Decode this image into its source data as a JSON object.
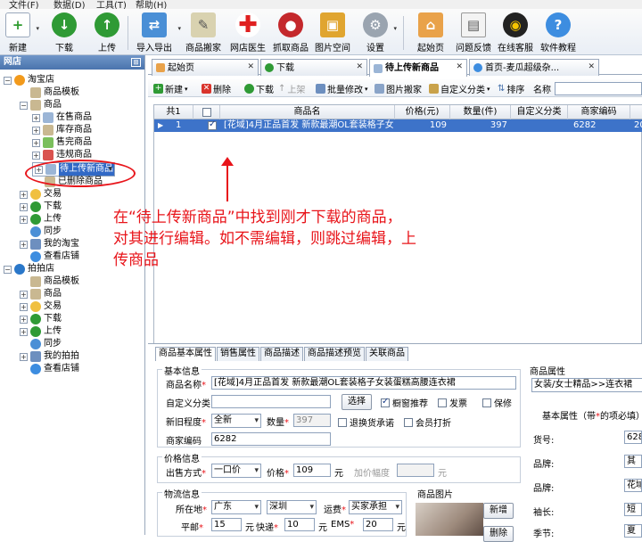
{
  "menu": {
    "items": [
      "文件(F)",
      "数据(D)",
      "工具(T)",
      "帮助(H)"
    ]
  },
  "toolbar": {
    "buttons": [
      {
        "label": "新建"
      },
      {
        "label": "下载"
      },
      {
        "label": "上传"
      },
      {
        "label": "导入导出"
      },
      {
        "label": "商品搬家"
      },
      {
        "label": "网店医生"
      },
      {
        "label": "抓取商品"
      },
      {
        "label": "图片空间"
      },
      {
        "label": "设置"
      },
      {
        "label": "起始页"
      },
      {
        "label": "问题反馈"
      },
      {
        "label": "在线客服"
      },
      {
        "label": "软件教程"
      }
    ]
  },
  "sidebar": {
    "title": "网店",
    "tree": [
      {
        "label": "淘宝店"
      },
      {
        "label": "商品模板"
      },
      {
        "label": "商品"
      },
      {
        "label": "在售商品"
      },
      {
        "label": "库存商品"
      },
      {
        "label": "售完商品"
      },
      {
        "label": "违规商品"
      },
      {
        "label": "待上传新商品"
      },
      {
        "label": "已删除商品"
      },
      {
        "label": "交易"
      },
      {
        "label": "下载"
      },
      {
        "label": "上传"
      },
      {
        "label": "同步"
      },
      {
        "label": "我的淘宝"
      },
      {
        "label": "查看店铺"
      },
      {
        "label": "拍拍店"
      },
      {
        "label": "商品模板"
      },
      {
        "label": "商品"
      },
      {
        "label": "交易"
      },
      {
        "label": "下载"
      },
      {
        "label": "上传"
      },
      {
        "label": "同步"
      },
      {
        "label": "我的拍拍"
      },
      {
        "label": "查看店铺"
      }
    ]
  },
  "tabs": [
    {
      "label": "起始页"
    },
    {
      "label": "下载"
    },
    {
      "label": "待上传新商品"
    },
    {
      "label": "首页-麦瓜超级杂..."
    }
  ],
  "subtoolbar": {
    "new": "新建",
    "delete": "删除",
    "download": "下载",
    "list": "上架",
    "batch": "批量修改",
    "move": "图片搬家",
    "category": "自定义分类",
    "sort": "排序",
    "name_label": "名称"
  },
  "grid": {
    "count_label": "共1",
    "columns": [
      "商品名",
      "价格(元)",
      "数量(件)",
      "自定义分类",
      "商家编码",
      "20"
    ],
    "rows": [
      {
        "index": "1",
        "name": "[花域]4月正品首发 新款最潮OL套装格子女...",
        "price": "109",
        "quantity": "397",
        "category": "",
        "code": "6282",
        "extra": "20"
      }
    ]
  },
  "annotation": {
    "text": "在“待上传新商品”中找到刚才下载的商品，对其进行编辑。如不需编辑，则跳过编辑，上传商品"
  },
  "detail": {
    "tabs": [
      "商品基本属性",
      "销售属性",
      "商品描述",
      "商品描述预览",
      "关联商品"
    ],
    "basic": {
      "legend": "基本信息",
      "name_label": "商品名称",
      "name_value": "[花域]4月正品首发 新款最潮OL套装格子女装蛋糕高腰连衣裙",
      "category_label": "自定义分类",
      "select_button": "选择",
      "window_recommend": "橱窗推荐",
      "invoice": "发票",
      "warranty": "保修",
      "condition_label": "新旧程度",
      "condition_value": "全新",
      "quantity_label": "数量",
      "quantity_value": "397",
      "return_policy": "退换货承诺",
      "member_discount": "会员打折",
      "code_label": "商家编码",
      "code_value": "6282"
    },
    "price": {
      "legend": "价格信息",
      "method_label": "出售方式",
      "method_value": "一口价",
      "price_label": "价格",
      "price_value": "109",
      "unit": "元",
      "increment_label": "加价幅度",
      "increment_unit": "元"
    },
    "logistics": {
      "legend": "物流信息",
      "location_label": "所在地",
      "province": "广东",
      "city": "深圳",
      "fee_label": "运费",
      "fee_value": "买家承担",
      "post_label": "平邮",
      "post_value": "15",
      "express_label": "快递",
      "express_value": "10",
      "ems_label": "EMS",
      "ems_value": "20",
      "unit": "元"
    },
    "image": {
      "legend": "商品图片",
      "add": "新增",
      "remove": "删除"
    },
    "attributes": {
      "legend": "商品属性",
      "category_path": "女装/女士精品>>连衣裙",
      "basic_title": "基本属性（带",
      "basic_title_star": "*",
      "basic_title_tail": "的项必填）",
      "rows": [
        {
          "label": "货号:",
          "value": "628"
        },
        {
          "label": "品牌:",
          "value": "其"
        },
        {
          "label": "品牌:",
          "value": "花域"
        },
        {
          "label": "袖长:",
          "value": "短"
        },
        {
          "label": "季节:",
          "value": "夏"
        }
      ]
    }
  },
  "colors": {
    "accent": "#e8141a",
    "selection": "#3d73c9",
    "header": "#4a74ad"
  }
}
